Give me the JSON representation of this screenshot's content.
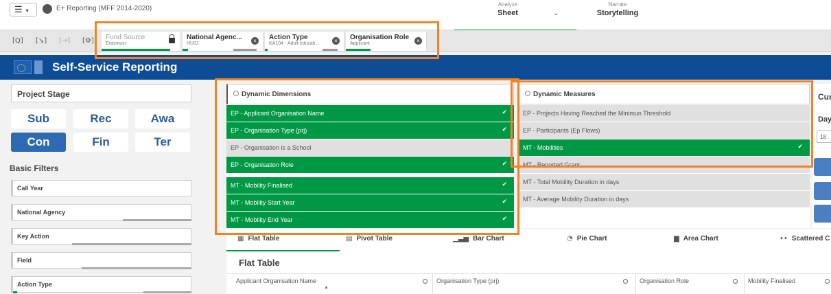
{
  "app": {
    "menu_glyph": "☰",
    "menu_caret": "▾",
    "title": "E+ Reporting (MFF 2014-2020)"
  },
  "nav": {
    "analyze_label": "Analyze",
    "analyze_value": "Sheet",
    "chevron": "⌄",
    "narrate_label": "Narrate",
    "narrate_value": "Storytelling"
  },
  "tools": [
    "[Q]",
    "[↘]",
    "[→]",
    "[⚙]"
  ],
  "selections": [
    {
      "field": "Fund Source",
      "value": "Erasmus+",
      "locked": true
    },
    {
      "field": "National Agenc...",
      "value": "HU01",
      "locked": false,
      "close": "×"
    },
    {
      "field": "Action Type",
      "value": "KA104 - Adult educati...",
      "locked": false,
      "close": "×"
    },
    {
      "field": "Organisation Role",
      "value": "Applicant",
      "locked": false,
      "close": "×"
    }
  ],
  "banner": {
    "title": "Self-Service Reporting"
  },
  "project_stage": {
    "title": "Project Stage",
    "buttons": [
      {
        "label": "Sub",
        "active": false
      },
      {
        "label": "Rec",
        "active": false
      },
      {
        "label": "Awa",
        "active": false
      },
      {
        "label": "Con",
        "active": true
      },
      {
        "label": "Fin",
        "active": false
      },
      {
        "label": "Ter",
        "active": false
      }
    ]
  },
  "basic_filters": {
    "title": "Basic Filters",
    "items": [
      "Call Year",
      "National Agency",
      "Key Action",
      "Field",
      "Action Type"
    ]
  },
  "dimensions": {
    "placeholder": "Dynamic Dimensions",
    "items": [
      {
        "label": "EP - Applicant Organisation Name",
        "state": "selected"
      },
      {
        "label": "EP - Organisation Type (prj)",
        "state": "selected"
      },
      {
        "label": "EP - Organisation is a School",
        "state": "alternative"
      },
      {
        "label": "EP - Organisation Role",
        "state": "selected"
      },
      {
        "label": "",
        "state": "gap"
      },
      {
        "label": "MT - Mobility Finalised",
        "state": "selected"
      },
      {
        "label": "MT - Mobility Start Year",
        "state": "selected"
      },
      {
        "label": "MT - Mobility End Year",
        "state": "selected"
      }
    ]
  },
  "measures": {
    "placeholder": "Dynamic Measures",
    "items": [
      {
        "label": "EP - Projects Having Reached the Minimun Threshold",
        "state": "alternative"
      },
      {
        "label": "EP - Participants (Ep Flows)",
        "state": "alternative"
      },
      {
        "label": "MT - Mobilities",
        "state": "selected"
      },
      {
        "label": "MT - Reported Grant",
        "state": "alternative"
      },
      {
        "label": "MT - Total Mobility Duration in days",
        "state": "alternative"
      },
      {
        "label": "MT - Average Mobility Duration in days",
        "state": "alternative"
      }
    ]
  },
  "check_glyph": "✔",
  "right_panel": {
    "title": "Cur",
    "subtitle": "Day",
    "input_value": "18"
  },
  "chart_tabs": [
    {
      "label": "Flat Table",
      "icon": "▦"
    },
    {
      "label": "Pivot Table",
      "icon": "▤"
    },
    {
      "label": "Bar Chart",
      "icon": "▁▃▅"
    },
    {
      "label": "Pie Chart",
      "icon": "◔"
    },
    {
      "label": "Area Chart",
      "icon": "▆"
    },
    {
      "label": "Scattered C",
      "icon": "••"
    }
  ],
  "table": {
    "title": "Flat Table",
    "columns": [
      "Applicant Organisation Name",
      "Organisation Type (prj)",
      "Organisation Role",
      "Mobility Finalised"
    ],
    "sort_arrow": "▲"
  },
  "colors": {
    "selected_green": "#009845",
    "banner_blue": "#0e4c96",
    "highlight_orange": "#f58220"
  }
}
